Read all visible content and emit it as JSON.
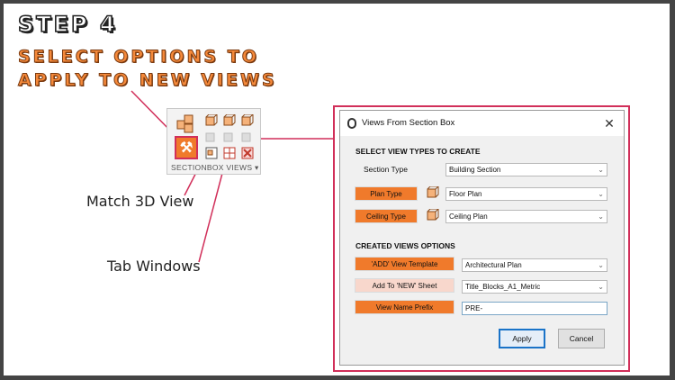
{
  "slide": {
    "step": "STEP 4",
    "subtitle_line1": "SELECT OPTIONS TO",
    "subtitle_line2": "APPLY TO NEW VIEWS",
    "annotation_match": "Match 3D View",
    "annotation_tab": "Tab Windows"
  },
  "ribbon": {
    "label": "SECTIONBOX VIEWS",
    "dropdown_glyph": "▾",
    "selected_glyph": "⚒"
  },
  "dialog": {
    "title": "Views From Section Box",
    "close_glyph": "✕",
    "section_types_header": "SELECT VIEW TYPES TO CREATE",
    "section_type_label": "Section Type",
    "section_type_value": "Building Section",
    "plan_type_button": "Plan Type",
    "plan_type_value": "Floor Plan",
    "ceiling_type_button": "Ceiling Type",
    "ceiling_type_value": "Ceiling Plan",
    "created_views_header": "CREATED VIEWS OPTIONS",
    "view_template_button": "'ADD' View Template",
    "view_template_value": "Architectural Plan",
    "sheet_button": "Add To 'NEW' Sheet",
    "sheet_value": "Title_Blocks_A1_Metric",
    "prefix_button": "View Name Prefix",
    "prefix_value": "PRE-",
    "apply_button": "Apply",
    "cancel_button": "Cancel",
    "dropdown_arrow": "⌄"
  },
  "colors": {
    "accent_orange": "#f07a2b",
    "accent_pink": "#d12f5a",
    "light_salmon": "#f8d7cc"
  }
}
